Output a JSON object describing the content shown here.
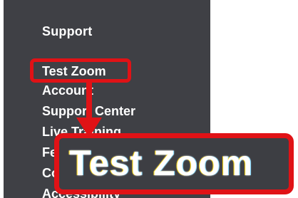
{
  "sidebar": {
    "heading": "Support",
    "items": [
      {
        "label": "Test Zoom"
      },
      {
        "label": "Account"
      },
      {
        "label": "Support Center"
      },
      {
        "label": "Live Training"
      },
      {
        "label": "Feedback"
      },
      {
        "label": "Contact Us"
      },
      {
        "label": "Accessibility"
      }
    ]
  },
  "callout": {
    "zoomed_label": "Test Zoom"
  },
  "colors": {
    "sidebar_bg": "#3f4045",
    "highlight": "#e01216",
    "text": "#ffffff"
  }
}
